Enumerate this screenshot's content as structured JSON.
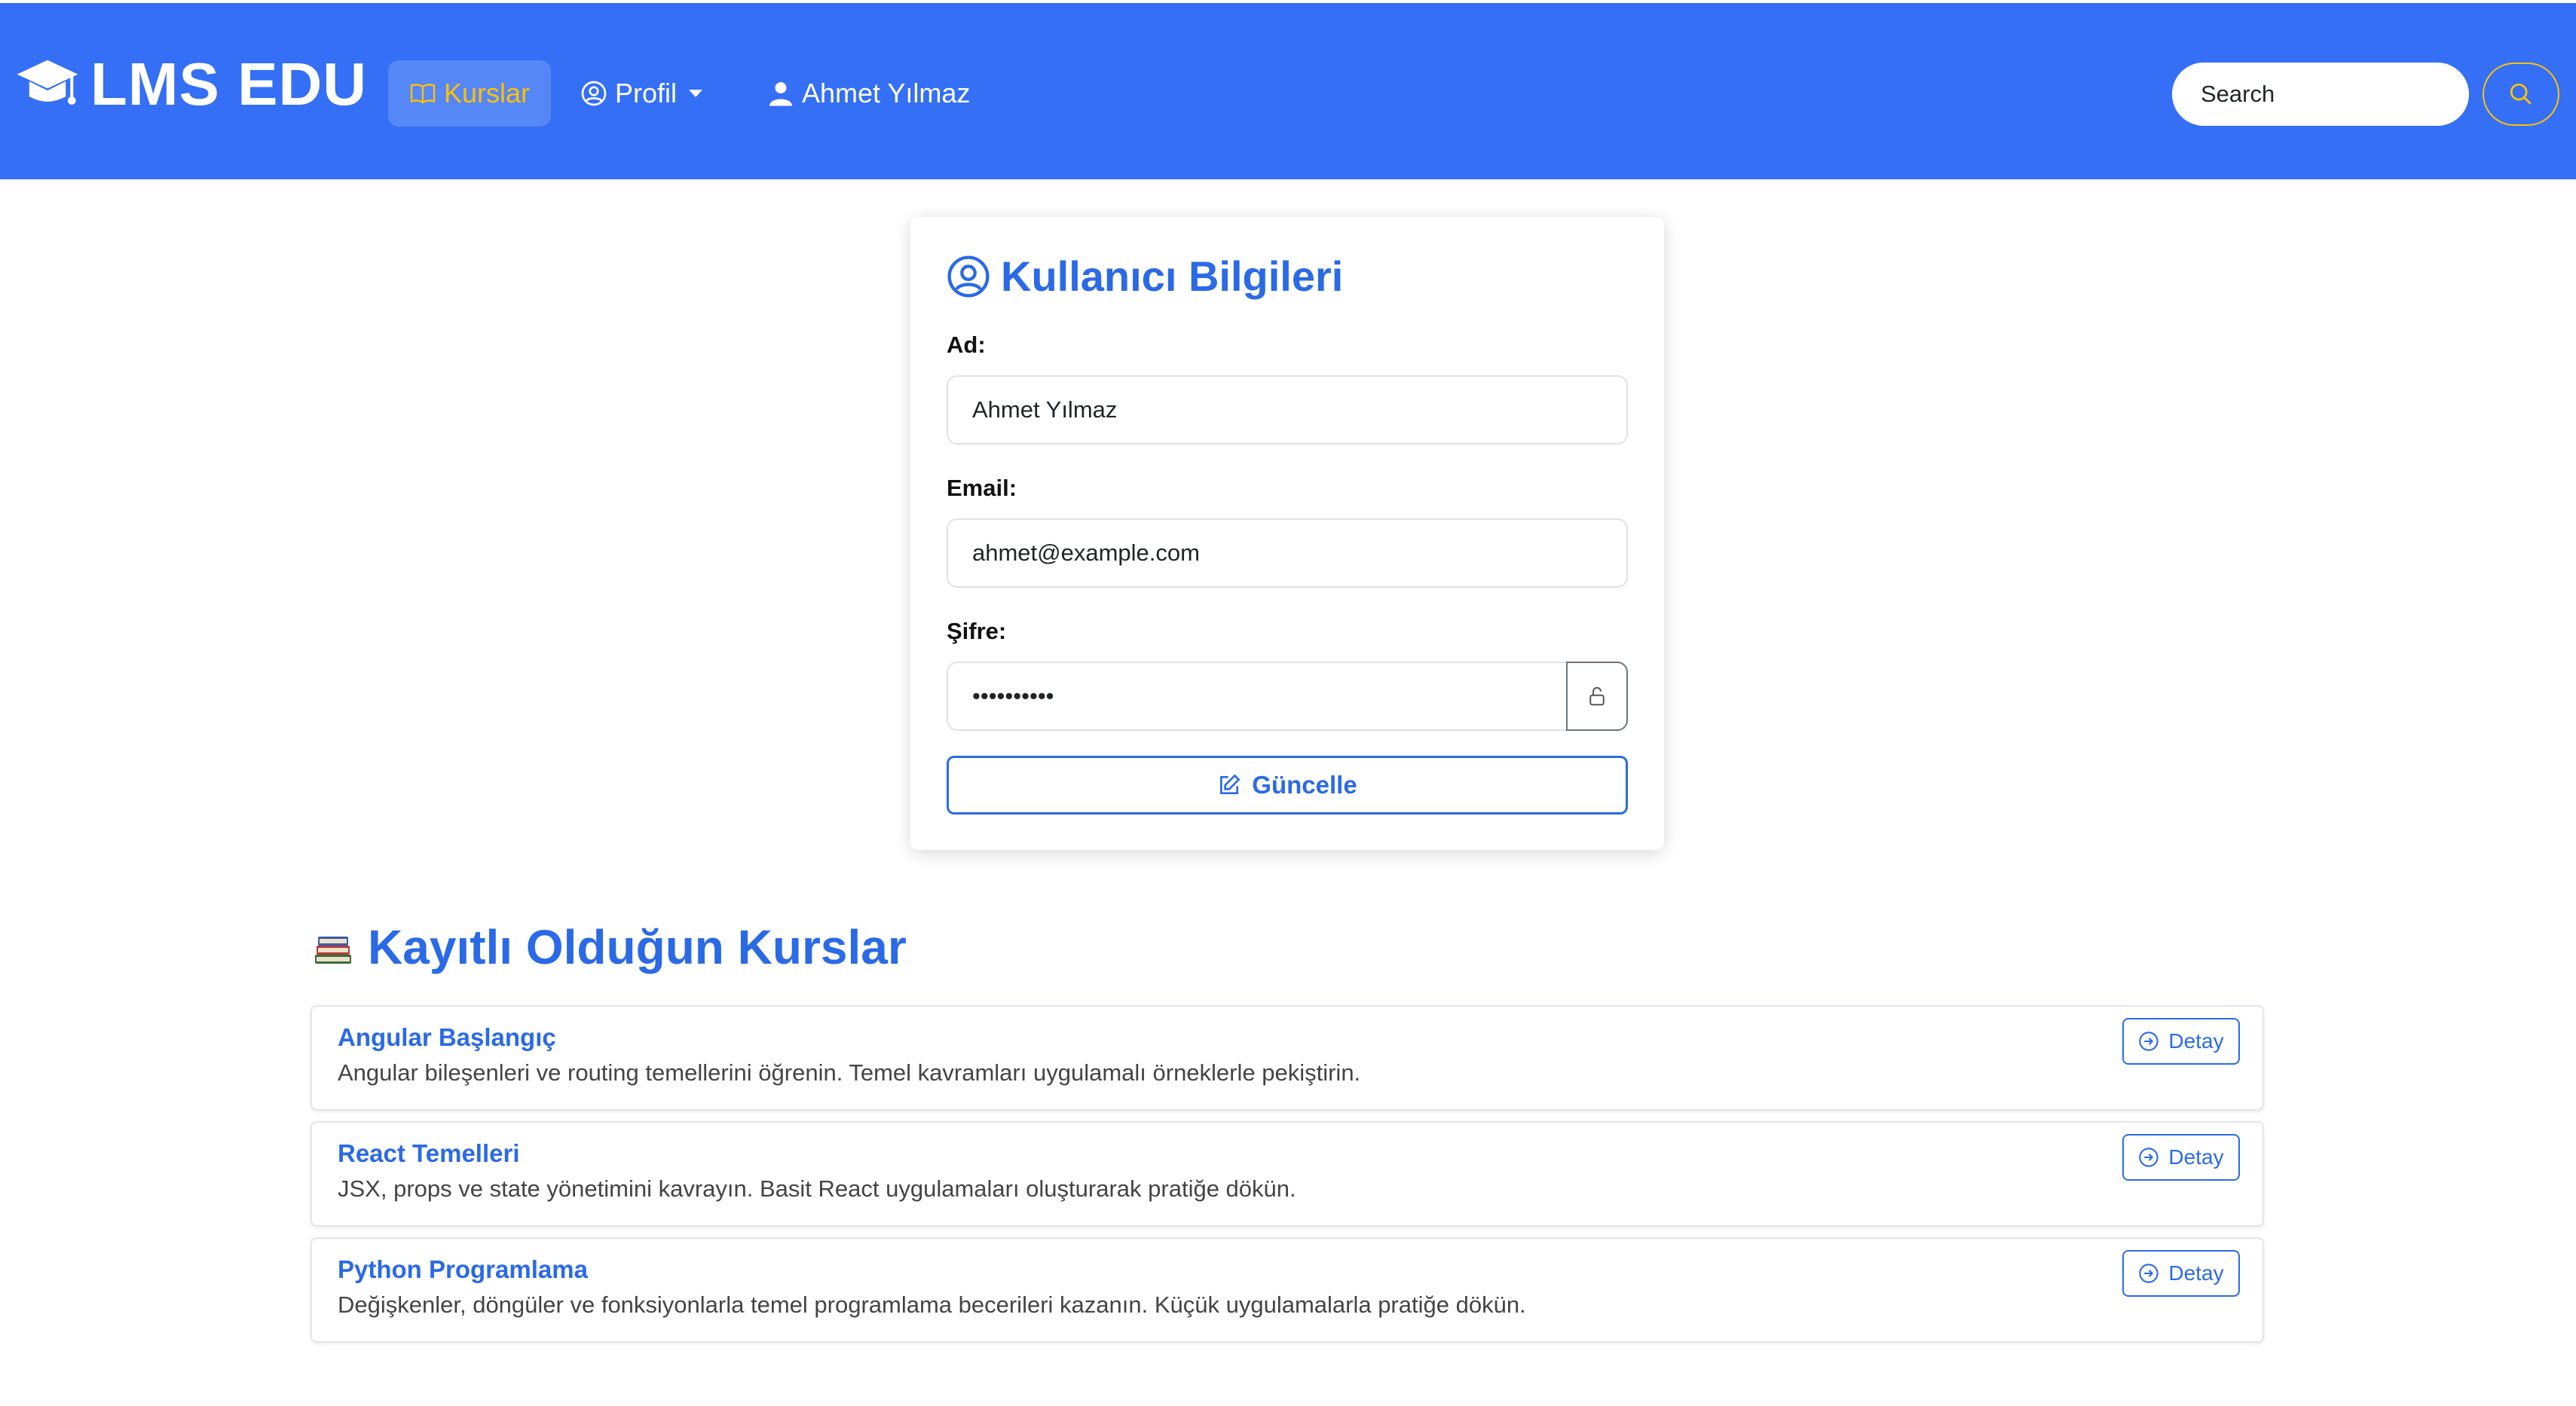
{
  "navbar": {
    "brand": "LMS EDU",
    "kurslar": "Kurslar",
    "profil": "Profil",
    "user_name": "Ahmet Yılmaz",
    "search_placeholder": "Search"
  },
  "profile_card": {
    "title": "Kullanıcı Bilgileri",
    "name_label": "Ad:",
    "name_value": "Ahmet Yılmaz",
    "email_label": "Email:",
    "email_value": "ahmet@example.com",
    "password_label": "Şifre:",
    "password_value": "••••••••••",
    "update_button": "Güncelle"
  },
  "courses_section": {
    "title": "Kayıtlı Olduğun Kurslar",
    "detail_label": "Detay",
    "items": [
      {
        "title": "Angular Başlangıç",
        "description": "Angular bileşenleri ve routing temellerini öğrenin. Temel kavramları uygulamalı örneklerle pekiştirin."
      },
      {
        "title": "React Temelleri",
        "description": "JSX, props ve state yönetimini kavrayın. Basit React uygulamaları oluşturarak pratiğe dökün."
      },
      {
        "title": "Python Programlama",
        "description": "Değişkenler, döngüler ve fonksiyonlarla temel programlama becerileri kazanın. Küçük uygulamalarla pratiğe dökün."
      }
    ]
  },
  "colors": {
    "navbar": "#346ff5",
    "accent": "#2b6ae6",
    "active_nav": "#ffc107"
  },
  "icons": [
    "graduation-cap-icon",
    "book-icon",
    "user-circle-icon",
    "caret-down-icon",
    "person-icon",
    "search-icon",
    "unlock-icon",
    "pencil-square-icon",
    "books-emoji-icon",
    "arrow-right-circle-icon"
  ]
}
